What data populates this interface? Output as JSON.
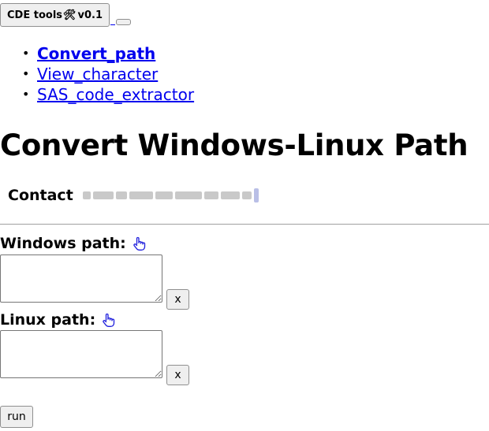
{
  "header": {
    "app_button_label": "CDE tools",
    "app_button_icon": "hammer-wrench-icon",
    "app_button_version": "v0.1",
    "underscore_link_label": "_"
  },
  "nav": {
    "items": [
      {
        "label": "Convert_path",
        "active": true
      },
      {
        "label": "View_character",
        "active": false
      },
      {
        "label": "SAS_code_extractor",
        "active": false
      }
    ]
  },
  "page": {
    "title": "Convert Windows-Linux Path",
    "contact_label": "Contact"
  },
  "form": {
    "windows_label": "Windows path:",
    "windows_value": "",
    "linux_label": "Linux path:",
    "linux_value": "",
    "clear_label": "x",
    "run_label": "run"
  },
  "colors": {
    "link": "#0000ee",
    "button_bg": "#efefef",
    "hand_icon": "#2222dd"
  }
}
